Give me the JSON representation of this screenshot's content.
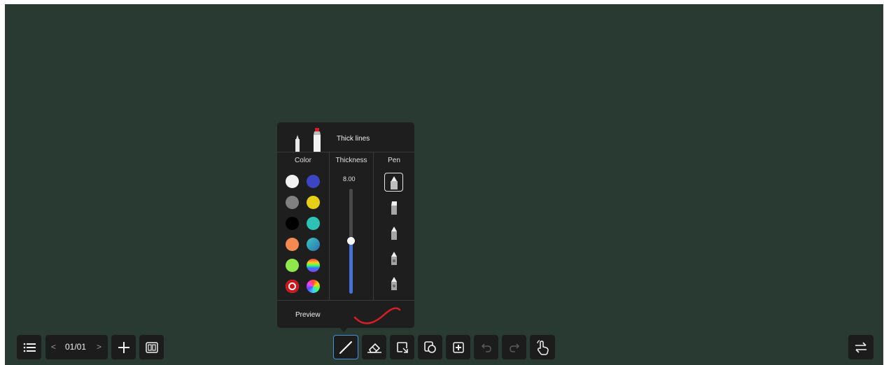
{
  "popup": {
    "title": "Thick lines",
    "color_label": "Color",
    "thickness_label": "Thickness",
    "pen_label": "Pen",
    "thickness_value": "8.00",
    "thickness_level": 0.5,
    "preview_label": "Preview",
    "preview_color": "#d61f26"
  },
  "colors": {
    "left": [
      "#f2f2f2",
      "#808080",
      "#000000",
      "#f48a52",
      "#8ee84b",
      "#d0141a"
    ],
    "right": [
      "#3c46c2",
      "#e6d015",
      "#2cc2b5",
      "#2f83b3",
      "rainbow",
      "spectrum"
    ],
    "selected": "#d0141a"
  },
  "toolbar": {
    "page_indicator": "01/01",
    "prev": "<",
    "next": ">",
    "add": "+"
  },
  "board_color": "#283a31"
}
